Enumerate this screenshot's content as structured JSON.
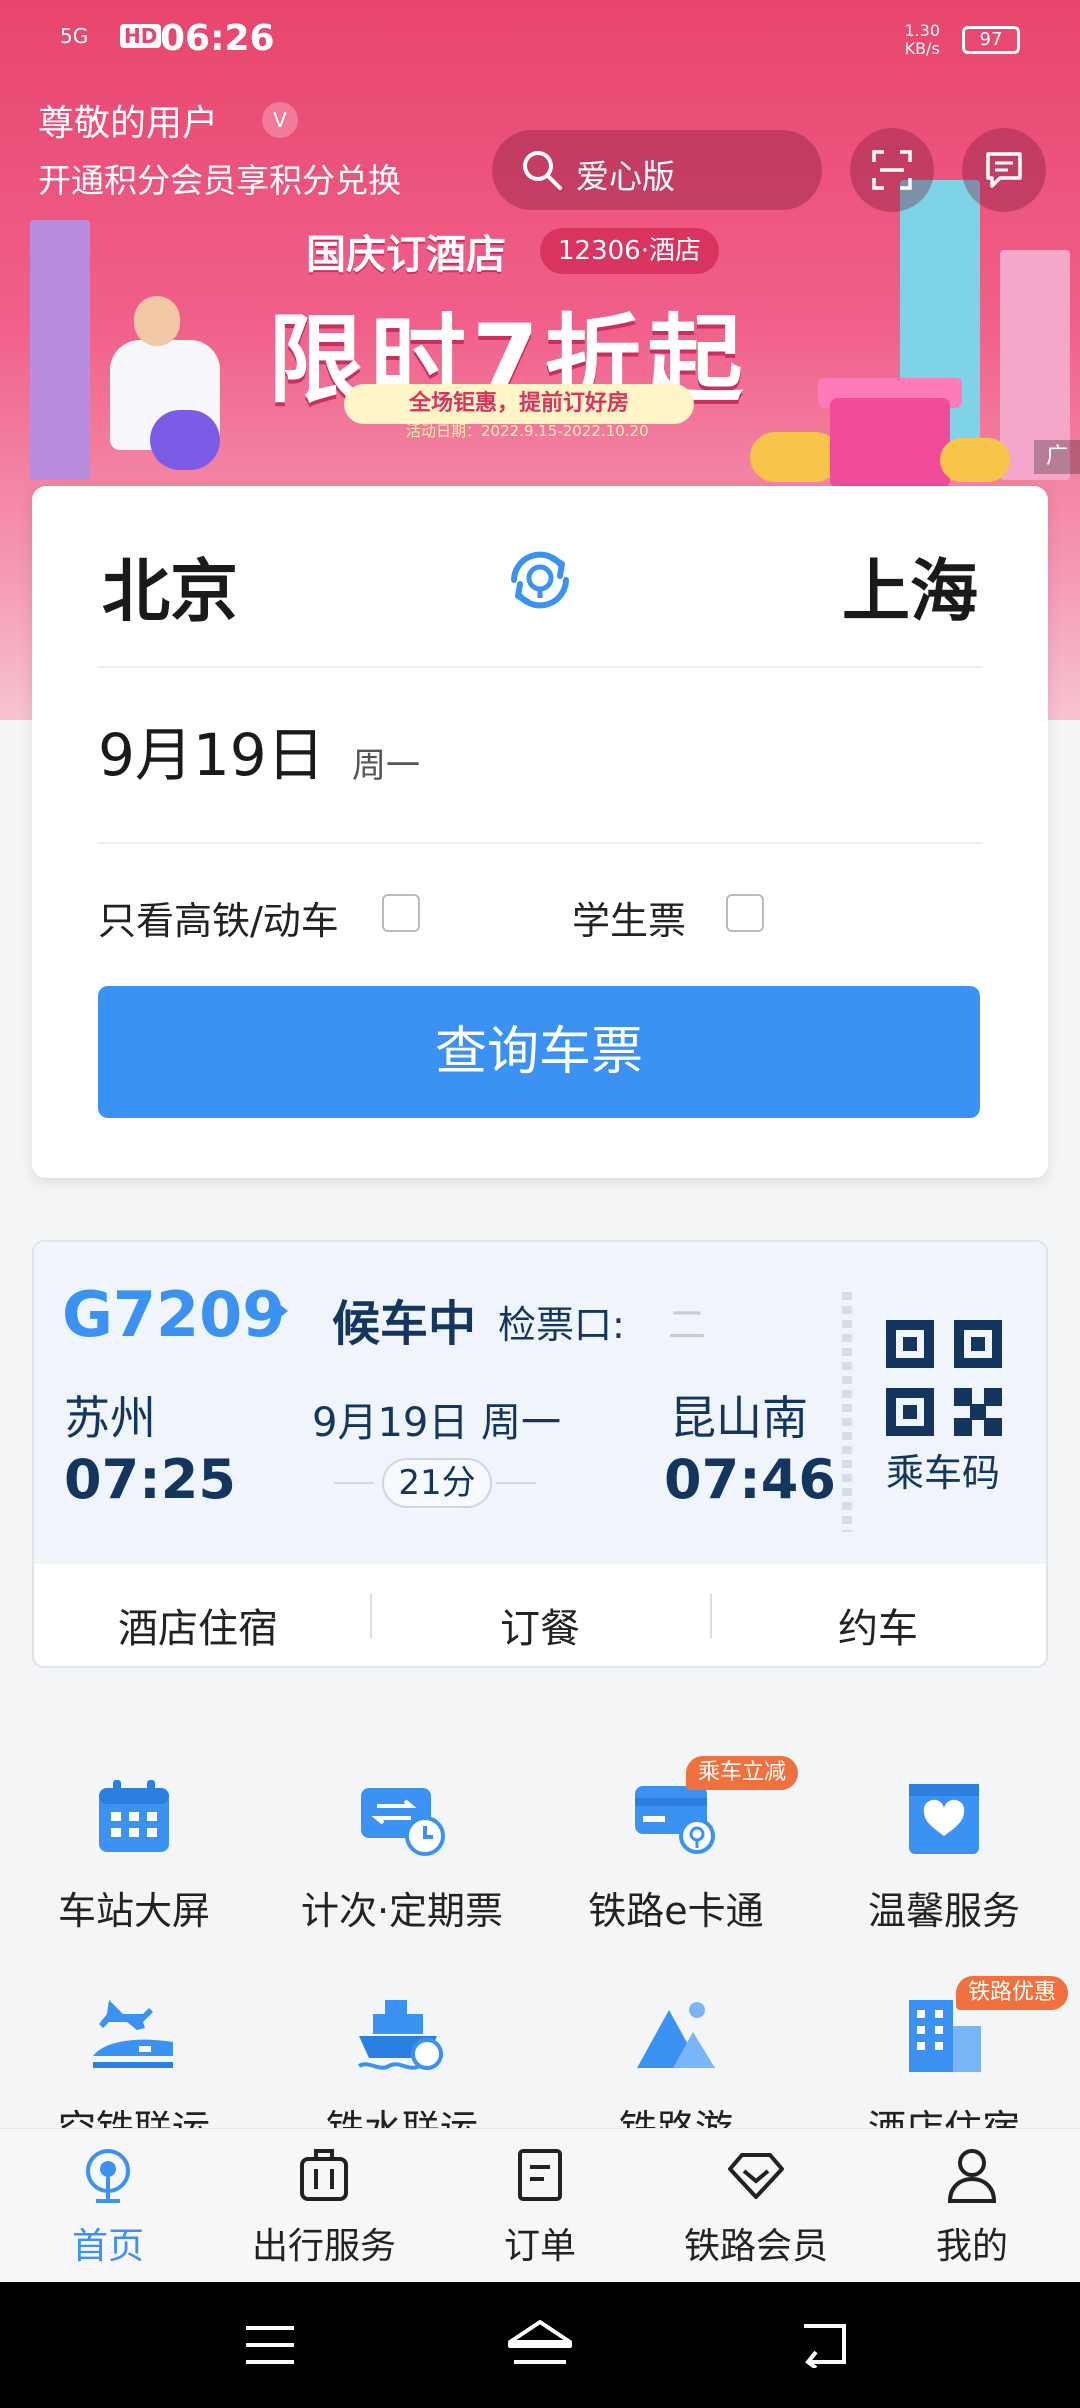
{
  "status_bar": {
    "signal": "5G",
    "hd": "HD",
    "time": "06:26",
    "speed_value": "1.30",
    "speed_unit": "KB/s",
    "battery": "97"
  },
  "header": {
    "user_name": "尊敬的用户",
    "vip_badge": "V",
    "member_promo": "开通积分会员享积分兑换",
    "search_label": "爱心版"
  },
  "banner": {
    "title": "国庆订酒店",
    "tag": "12306·酒店",
    "headline": "限时7折起",
    "subline": "全场钜惠，提前订好房",
    "dates": "活动日期：2022.9.15-2022.10.20",
    "ad_label": "广"
  },
  "booking": {
    "from_city": "北京",
    "to_city": "上海",
    "date": "9月19日",
    "weekday": "周一",
    "option_high_speed": "只看高铁/动车",
    "option_student": "学生票",
    "high_speed_checked": false,
    "student_checked": false,
    "query_button": "查询车票"
  },
  "trip": {
    "train_no": "G7209",
    "status": "候车中",
    "gate_label": "检票口:",
    "gate_value": "二",
    "from_station": "苏州",
    "from_time": "07:25",
    "date": "9月19日 周一",
    "duration": "21分",
    "to_station": "昆山南",
    "to_time": "07:46",
    "qr_label": "乘车码",
    "services": [
      "酒店住宿",
      "订餐",
      "约车"
    ]
  },
  "grid": [
    {
      "label": "车站大屏",
      "icon": "calendar-icon"
    },
    {
      "label": "计次·定期票",
      "icon": "ticket-clock-icon"
    },
    {
      "label": "铁路e卡通",
      "icon": "card-icon",
      "badge": "乘车立减"
    },
    {
      "label": "温馨服务",
      "icon": "heart-bag-icon"
    },
    {
      "label": "空铁联运",
      "icon": "plane-train-icon"
    },
    {
      "label": "铁水联运",
      "icon": "ship-icon"
    },
    {
      "label": "铁路游",
      "icon": "mountain-icon"
    },
    {
      "label": "酒店住宿",
      "icon": "building-icon",
      "badge": "铁路优惠"
    }
  ],
  "tabs": [
    {
      "label": "首页",
      "icon": "home-rail-icon",
      "active": true
    },
    {
      "label": "出行服务",
      "icon": "luggage-icon",
      "active": false
    },
    {
      "label": "订单",
      "icon": "order-icon",
      "active": false
    },
    {
      "label": "铁路会员",
      "icon": "diamond-icon",
      "active": false
    },
    {
      "label": "我的",
      "icon": "user-icon",
      "active": false
    }
  ],
  "colors": {
    "accent": "#3b92f2",
    "banner": "#e8456d",
    "badge": "#f2703d",
    "dark_text": "#14365e"
  }
}
